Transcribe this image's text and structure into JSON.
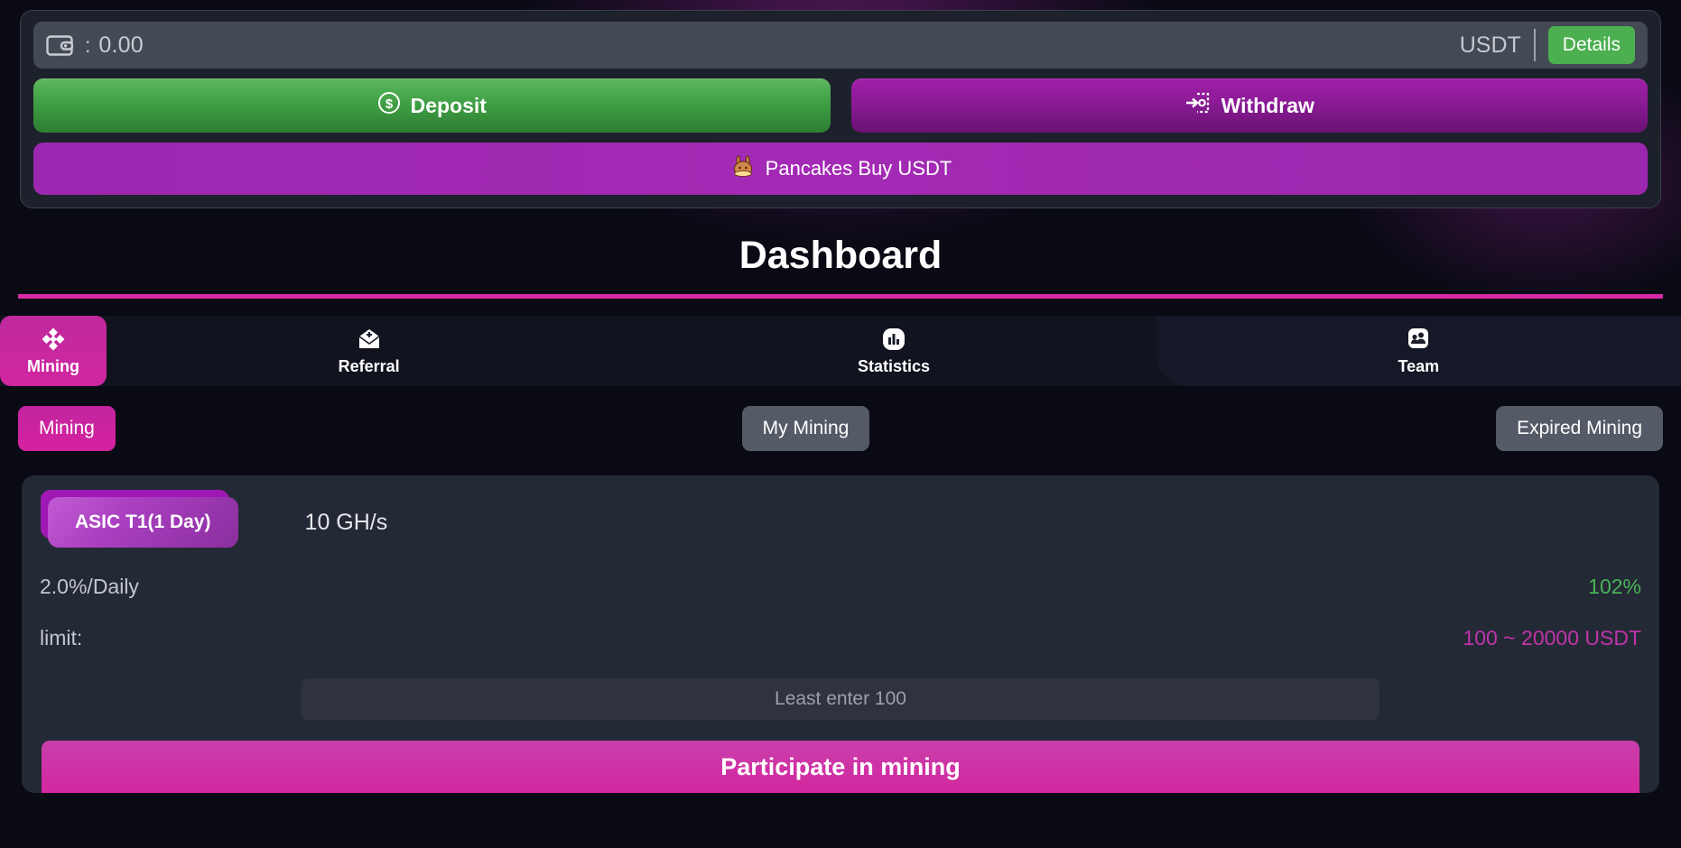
{
  "wallet": {
    "icon": "wallet-icon",
    "separator": ":",
    "balance": "0.00",
    "currency": "USDT",
    "details_label": "Details"
  },
  "actions": {
    "deposit_label": "Deposit",
    "deposit_icon": "dollar-circle-icon",
    "withdraw_label": "Withdraw",
    "withdraw_icon": "withdraw-arrow-icon",
    "pancakes_label": "Pancakes Buy USDT",
    "pancakes_icon": "pancakeswap-bunny-icon"
  },
  "header": {
    "title": "Dashboard"
  },
  "nav": {
    "tabs": [
      {
        "label": "Mining",
        "icon": "binance-diamond-icon",
        "active": true
      },
      {
        "label": "Referral",
        "icon": "envelope-plus-icon",
        "active": false
      },
      {
        "label": "Statistics",
        "icon": "bar-chart-icon",
        "active": false
      },
      {
        "label": "Team",
        "icon": "people-group-icon",
        "active": false
      }
    ]
  },
  "filters": {
    "mining_label": "Mining",
    "my_mining_label": "My Mining",
    "expired_mining_label": "Expired Mining"
  },
  "mining_card": {
    "plan_label": "ASIC T1(1 Day)",
    "hashrate": "10 GH/s",
    "daily_rate": "2.0%/Daily",
    "total_return": "102%",
    "limit_label": "limit:",
    "limit_range": "100 ~ 20000 USDT",
    "input_value": "",
    "input_placeholder": "Least enter 100",
    "cta_label": "Participate in mining"
  },
  "colors": {
    "accent_magenta": "#d4279f",
    "accent_purple": "#9c27b0",
    "success_green": "#4caf50",
    "page_bg": "#0a0a14",
    "panel_bg": "#242936"
  }
}
